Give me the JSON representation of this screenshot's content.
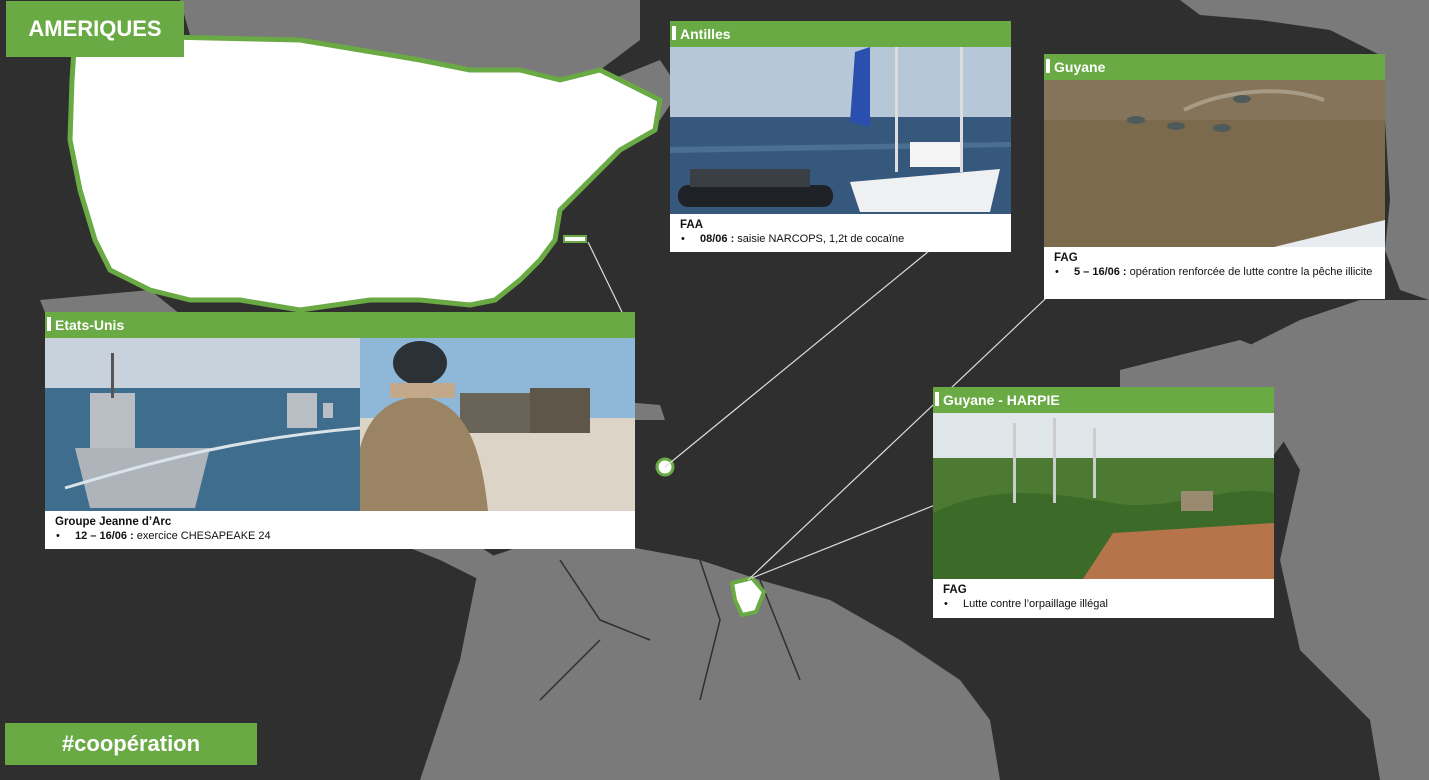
{
  "region_title": "AMERIQUES",
  "hashtag": "#coopération",
  "colors": {
    "accent": "#6aaa44",
    "ocean": "#2f2f2f",
    "land": "#7a7a7a",
    "highlight_land": "#ffffff"
  },
  "cards": {
    "antilles": {
      "title": "Antilles",
      "org": "FAA",
      "items": [
        {
          "date": "08/06 :",
          "text": " saisie NARCOPS, 1,2t de cocaïne"
        }
      ]
    },
    "guyane": {
      "title": "Guyane",
      "org": "FAG",
      "items": [
        {
          "date": "5 – 16/06 :",
          "text": " opération renforcée de lutte contre la pêche illicite"
        }
      ]
    },
    "etats_unis": {
      "title": "Etats-Unis",
      "org": "Groupe Jeanne d’Arc",
      "items": [
        {
          "date": "12 – 16/06 :",
          "text": " exercice CHESAPEAKE 24"
        }
      ]
    },
    "harpie": {
      "title": "Guyane - HARPIE",
      "org": "FAG",
      "items": [
        {
          "date": "",
          "text": "Lutte contre l’orpaillage illégal"
        }
      ]
    }
  },
  "photos": {
    "antilles": "sailboat-boarding-photo",
    "guyane": "aerial-river-boats-photo",
    "etats_unis_1": "warships-convoy-photo",
    "etats_unis_2": "soldier-beach-landing-photo",
    "harpie": "deforested-mining-site-photo"
  }
}
